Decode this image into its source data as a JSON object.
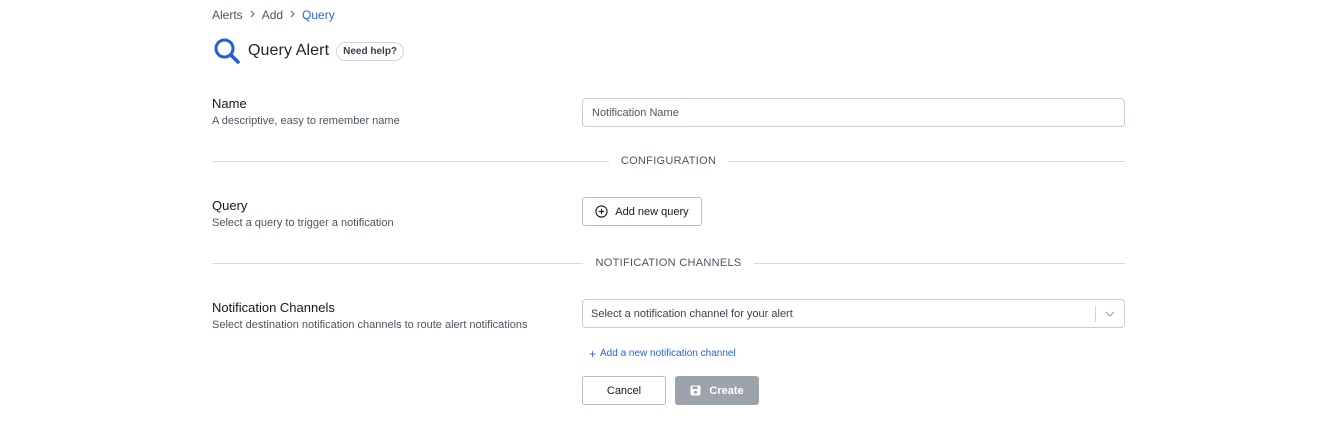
{
  "breadcrumb": {
    "items": [
      "Alerts",
      "Add",
      "Query"
    ]
  },
  "header": {
    "icon": "search-icon",
    "title": "Query Alert",
    "help_label": "Need help?"
  },
  "name_section": {
    "label": "Name",
    "description": "A descriptive, easy to remember name",
    "placeholder": "Notification Name",
    "value": ""
  },
  "configuration_divider": "CONFIGURATION",
  "query_section": {
    "label": "Query",
    "description": "Select a query to trigger a notification",
    "add_button_label": "Add new query",
    "add_button_icon": "plus-circle-icon"
  },
  "channels_divider": "NOTIFICATION CHANNELS",
  "channels_section": {
    "label": "Notification Channels",
    "description": "Select destination notification channels to route alert notifications",
    "select_placeholder": "Select a notification channel for your alert",
    "add_channel_label": "Add a new notification channel"
  },
  "actions": {
    "cancel_label": "Cancel",
    "create_label": "Create",
    "create_icon": "save-icon"
  },
  "colors": {
    "accent": "#2563eb",
    "disabled_button": "#9ca3ab",
    "divider": "#d6d9dd"
  }
}
